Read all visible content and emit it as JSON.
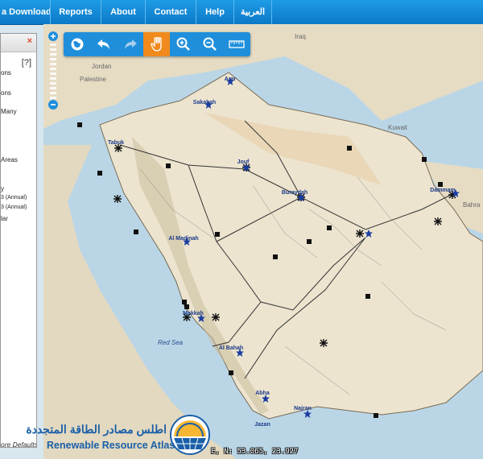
{
  "nav": {
    "items": [
      "a Download",
      "Reports",
      "About",
      "Contact",
      "Help",
      "العربية"
    ]
  },
  "panel": {
    "close": "×",
    "help": "[?]",
    "labels": [
      "ons",
      "ons",
      "Many",
      "Areas",
      "y",
      "3 (Annual)",
      "3 (Annual)",
      "lar"
    ],
    "defaults": "ore Defaults"
  },
  "map": {
    "countries": [
      "Iraq",
      "Jordan",
      "Palestine",
      "Kuwait",
      "Bahra"
    ],
    "sea": "Red Sea",
    "cities": [
      "Arar",
      "Sakakah",
      "Tabuk",
      "Jouf",
      "Buraydah",
      "Dammam",
      "Al Madinah",
      "Makkah",
      "Al Bahah",
      "Abha",
      "Najran",
      "Jazan"
    ]
  },
  "toolbar": {
    "tools": [
      "globe-icon",
      "undo-icon",
      "redo-icon",
      "pan-hand-icon",
      "zoom-in-icon",
      "zoom-out-icon",
      "measure-icon"
    ],
    "active": "pan-hand-icon"
  },
  "branding": {
    "arabic": "اطلس مصادر الطاقة المتجددة",
    "english": "Renewable Resource Atlas"
  },
  "coords": "E, N: 53.065, 23.927",
  "colors": {
    "nav": "#0b78c8",
    "toolbar": "#1f8fdb",
    "active_tool": "#f08a1c",
    "land": "#ece4cf",
    "sea": "#bad6e6"
  }
}
